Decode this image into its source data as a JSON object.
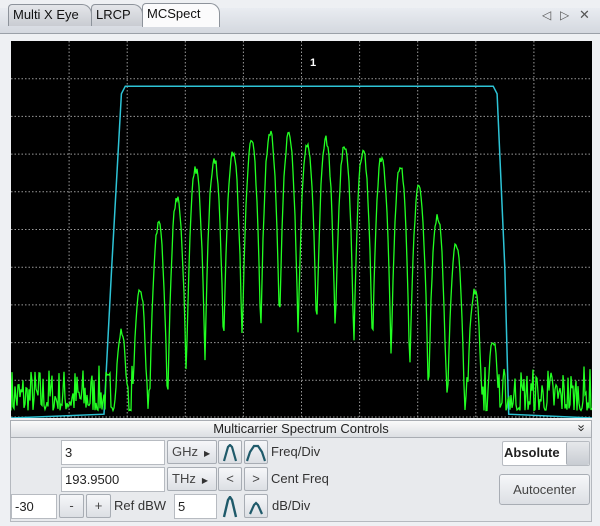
{
  "tabs": [
    {
      "label": "Multi X Eye"
    },
    {
      "label": "LRCP"
    },
    {
      "label": "MCSpect",
      "active": true
    }
  ],
  "tab_icons": {
    "prev": "◁",
    "next": "▷",
    "close": "✕"
  },
  "controls": {
    "title": "Multicarrier Spectrum Controls",
    "collapse_icon": "»",
    "freq_div_value": "3",
    "freq_div_unit": "GHz",
    "freq_div_label": "Freq/Div",
    "cent_freq_value": "193.9500",
    "cent_freq_unit": "THz",
    "cent_freq_label": "Cent Freq",
    "cent_left": "<",
    "cent_right": ">",
    "ref_value": "-30",
    "ref_minus": "-",
    "ref_plus": "+",
    "ref_label": "Ref dBW",
    "db_div_value": "5",
    "db_div_label": "dB/Div",
    "absolute_label": "Absolute",
    "autocenter_label": "Autocenter"
  },
  "colors": {
    "trace": "#22ff22",
    "mask": "#2ec4d6",
    "grid": "#9a9a9a",
    "background": "#000000"
  },
  "chart_data": {
    "type": "line",
    "marker_label": "1",
    "x_unit": "GHz offset from center",
    "xlim": [
      -15,
      15
    ],
    "ylim": [
      -80,
      -30
    ],
    "x_divisions": 10,
    "y_divisions": 10,
    "grid": true,
    "series": [
      {
        "name": "spectrum",
        "carrier_offsets_ghz": [
          -9.3,
          -8.34,
          -7.38,
          -6.42,
          -5.46,
          -4.5,
          -3.54,
          -2.58,
          -1.62,
          -0.66,
          0.3,
          1.26,
          2.22,
          3.18,
          4.14,
          5.1,
          6.06,
          7.02,
          7.98,
          8.94,
          9.9
        ],
        "carrier_peaks_dbw": [
          -68.3,
          -63.0,
          -54.4,
          -50.7,
          -47.1,
          -45.8,
          -44.7,
          -43.4,
          -42.1,
          -42.5,
          -43.5,
          -43.1,
          -43.8,
          -44.5,
          -45.5,
          -46.7,
          -49.5,
          -53.1,
          -57.1,
          -63.0,
          -69.7
        ],
        "noise_floor_dbw": -78
      },
      {
        "name": "mask",
        "x": [
          -15,
          -10.2,
          -9.8,
          -9.3,
          -9.1,
          9.9,
          10.1,
          10.5,
          10.7,
          15
        ],
        "y": [
          -80,
          -79.5,
          -60,
          -37,
          -36,
          -36,
          -37,
          -60,
          -79.5,
          -80
        ]
      }
    ]
  }
}
